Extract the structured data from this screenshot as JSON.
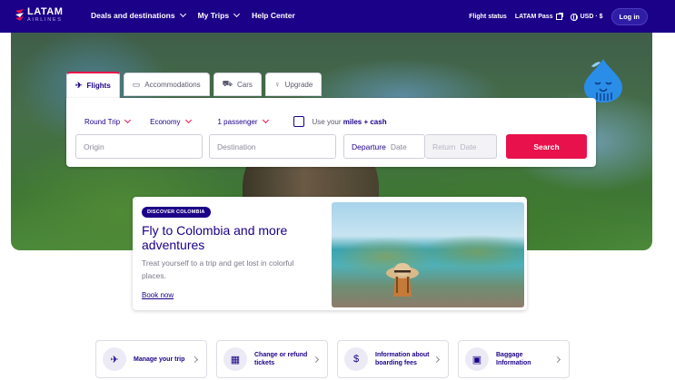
{
  "brand": {
    "name": "LATAM",
    "subname": "AIRLINES",
    "primary_color": "#1b0088",
    "accent_color": "#e8114b"
  },
  "topnav": {
    "items": [
      {
        "label": "Deals and destinations",
        "has_dropdown": true
      },
      {
        "label": "My Trips",
        "has_dropdown": true
      },
      {
        "label": "Help Center",
        "has_dropdown": false
      }
    ],
    "flight_status": "Flight status",
    "latam_pass": "LATAM Pass",
    "currency": "USD · $",
    "login": "Log in"
  },
  "search": {
    "tabs": [
      {
        "label": "Flights",
        "icon": "plane-icon",
        "active": true
      },
      {
        "label": "Accommodations",
        "icon": "bed-icon",
        "active": false
      },
      {
        "label": "Cars",
        "icon": "car-icon",
        "active": false
      },
      {
        "label": "Upgrade",
        "icon": "upgrade-icon",
        "active": false
      }
    ],
    "trip_type": "Round Trip",
    "cabin": "Economy",
    "passengers": "1 passenger",
    "miles_prefix": "Use your",
    "miles_bold": "miles + cash",
    "origin_placeholder": "Origin",
    "destination_placeholder": "Destination",
    "departure_label": "Departure",
    "departure_placeholder": "Date",
    "return_label": "Return",
    "return_placeholder": "Date",
    "button": "Search"
  },
  "promo": {
    "badge": "DISCOVER COLOMBIA",
    "title": "Fly to Colombia and more adventures",
    "description": "Treat yourself to a trip and get lost in colorful places.",
    "link": "Book now"
  },
  "quick_links": [
    {
      "label": "Manage your trip",
      "icon": "plane-ticket-icon"
    },
    {
      "label": "Change or refund tickets",
      "icon": "calendar-icon"
    },
    {
      "label": "Information about boarding fees",
      "icon": "money-icon"
    },
    {
      "label": "Baggage Information",
      "icon": "baggage-icon"
    }
  ]
}
